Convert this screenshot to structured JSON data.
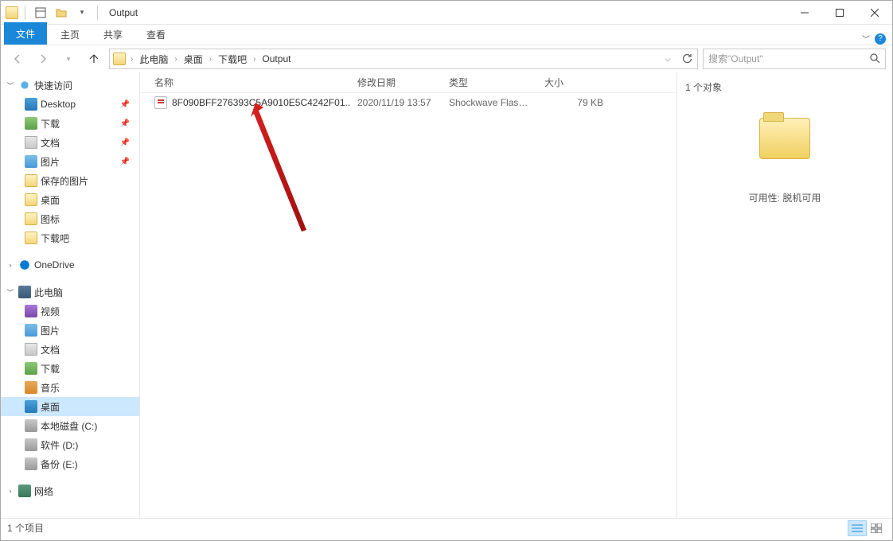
{
  "titlebar": {
    "title": "Output"
  },
  "ribbon": {
    "file": "文件",
    "home": "主页",
    "share": "共享",
    "view": "查看"
  },
  "breadcrumb": {
    "items": [
      "此电脑",
      "桌面",
      "下载吧",
      "Output"
    ]
  },
  "search": {
    "placeholder": "搜索\"Output\""
  },
  "sidebar": {
    "quick_access": "快速访问",
    "pinned": {
      "desktop": "Desktop",
      "downloads": "下载",
      "documents": "文档",
      "pictures": "图片"
    },
    "saved_pictures": "保存的图片",
    "desktop2": "桌面",
    "icons": "图标",
    "xiazaiba": "下载吧",
    "onedrive": "OneDrive",
    "this_pc": "此电脑",
    "videos": "视频",
    "pictures2": "图片",
    "documents2": "文档",
    "downloads2": "下载",
    "music": "音乐",
    "desktop3": "桌面",
    "disk_c": "本地磁盘 (C:)",
    "disk_d": "软件 (D:)",
    "disk_e": "备份 (E:)",
    "network": "网络"
  },
  "columns": {
    "name": "名称",
    "date": "修改日期",
    "type": "类型",
    "size": "大小"
  },
  "files": [
    {
      "name": "8F090BFF276393C5A9010E5C4242F01...",
      "date": "2020/11/19 13:57",
      "type": "Shockwave Flash...",
      "size": "79 KB"
    }
  ],
  "preview": {
    "title": "1 个对象",
    "status": "可用性: 脱机可用"
  },
  "statusbar": {
    "count": "1 个项目"
  }
}
